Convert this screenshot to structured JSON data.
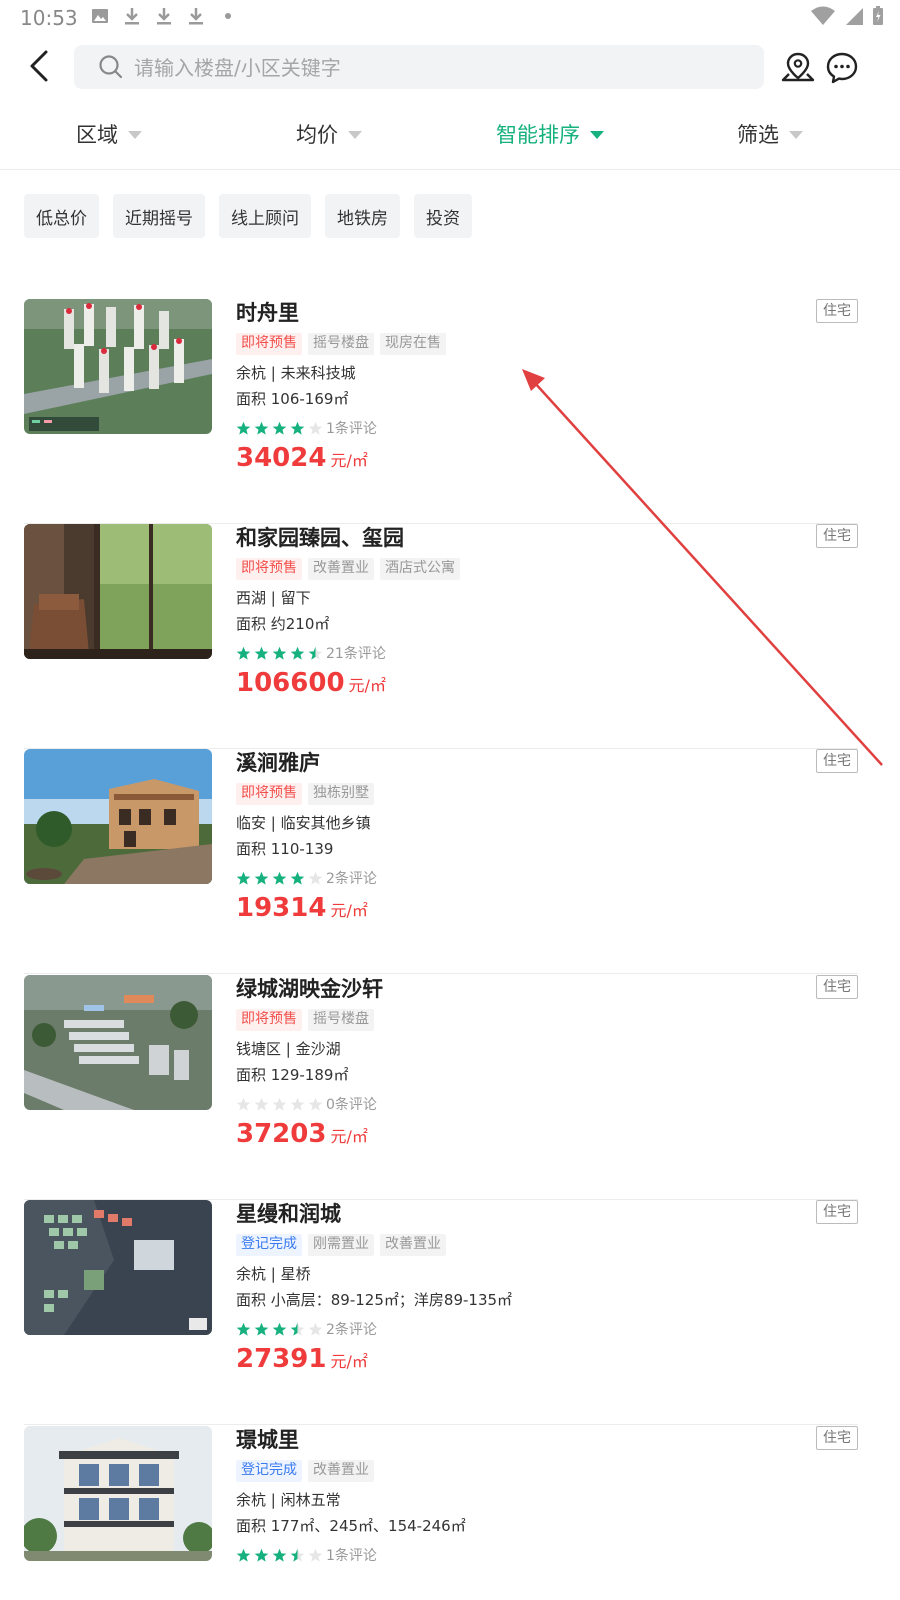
{
  "status_bar": {
    "time": "10:53"
  },
  "search": {
    "placeholder": "请输入楼盘/小区关键字"
  },
  "filters": [
    {
      "label": "区域",
      "active": false
    },
    {
      "label": "均价",
      "active": false
    },
    {
      "label": "智能排序",
      "active": true
    },
    {
      "label": "筛选",
      "active": false
    }
  ],
  "quick_tags": [
    "低总价",
    "近期摇号",
    "线上顾问",
    "地铁房",
    "投资"
  ],
  "listings": [
    {
      "title": "时舟里",
      "badges": [
        {
          "text": "即将预售",
          "style": "red"
        },
        {
          "text": "摇号楼盘",
          "style": "gray"
        },
        {
          "text": "现房在售",
          "style": "gray"
        }
      ],
      "location": "余杭 | 未来科技城",
      "area": "面积 106-169㎡",
      "rating": 4,
      "reviews": "1条评论",
      "price": "34024",
      "price_unit": "元/㎡",
      "type": "住宅"
    },
    {
      "title": "和家园臻园、玺园",
      "badges": [
        {
          "text": "即将预售",
          "style": "red"
        },
        {
          "text": "改善置业",
          "style": "gray"
        },
        {
          "text": "酒店式公寓",
          "style": "gray"
        }
      ],
      "location": "西湖 | 留下",
      "area": "面积 约210㎡",
      "rating": 4.5,
      "reviews": "21条评论",
      "price": "106600",
      "price_unit": "元/㎡",
      "type": "住宅"
    },
    {
      "title": "溪涧雅庐",
      "badges": [
        {
          "text": "即将预售",
          "style": "red"
        },
        {
          "text": "独栋别墅",
          "style": "gray"
        }
      ],
      "location": "临安 | 临安其他乡镇",
      "area": "面积 110-139",
      "rating": 4,
      "reviews": "2条评论",
      "price": "19314",
      "price_unit": "元/㎡",
      "type": "住宅"
    },
    {
      "title": "绿城湖映金沙轩",
      "badges": [
        {
          "text": "即将预售",
          "style": "red"
        },
        {
          "text": "摇号楼盘",
          "style": "gray"
        }
      ],
      "location": "钱塘区 | 金沙湖",
      "area": "面积 129-189㎡",
      "rating": 0,
      "reviews": "0条评论",
      "price": "37203",
      "price_unit": "元/㎡",
      "type": "住宅"
    },
    {
      "title": "星缦和润城",
      "badges": [
        {
          "text": "登记完成",
          "style": "blue"
        },
        {
          "text": "刚需置业",
          "style": "gray"
        },
        {
          "text": "改善置业",
          "style": "gray"
        }
      ],
      "location": "余杭 | 星桥",
      "area": "面积 小高层：89-125㎡；洋房89-135㎡",
      "rating": 3.5,
      "reviews": "2条评论",
      "price": "27391",
      "price_unit": "元/㎡",
      "type": "住宅"
    },
    {
      "title": "璟城里",
      "badges": [
        {
          "text": "登记完成",
          "style": "blue"
        },
        {
          "text": "改善置业",
          "style": "gray"
        }
      ],
      "location": "余杭 | 闲林五常",
      "area": "面积 177㎡、245㎡、154-246㎡",
      "rating": 3.5,
      "reviews": "1条评论",
      "price": "",
      "price_unit": "",
      "type": "住宅"
    }
  ],
  "colors": {
    "accent": "#16b17e",
    "price": "#ef3b3b",
    "star": "#16b17e",
    "annotation": "#e04040"
  }
}
